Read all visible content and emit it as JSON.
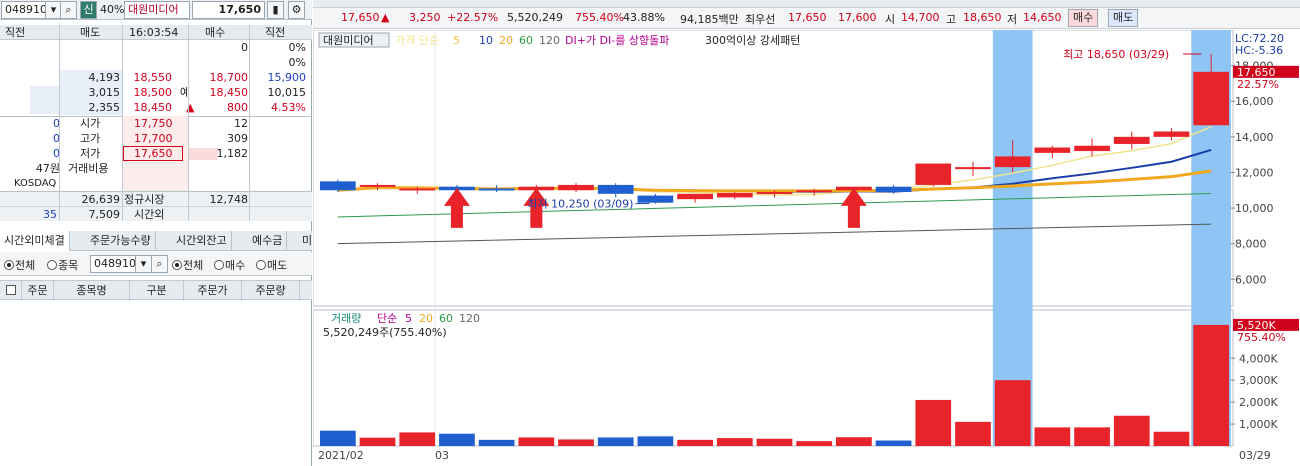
{
  "stock": {
    "code": "048910",
    "badge_credit": "신",
    "margin_rate": "40%",
    "name": "대원미디어",
    "price": "17,650"
  },
  "orderbook": {
    "headers": [
      "직전",
      "매도",
      "16:03:54",
      "매수",
      "직전"
    ],
    "rows": [
      {
        "c1": "",
        "sell": "",
        "price": "",
        "buy": "0",
        "c5": "0%"
      },
      {
        "c1": "",
        "sell": "",
        "price": "",
        "buy": "",
        "c5": "0%"
      },
      {
        "c1": "",
        "sell": "4,193",
        "price": "18,550",
        "buy": "18,700",
        "c5": "15,900"
      },
      {
        "c1": "",
        "sell": "3,015",
        "price": "18,500",
        "buy": "18,450",
        "c5": "10,015",
        "buy_prefix": "예"
      },
      {
        "c1": "",
        "sell": "2,355",
        "price": "18,450",
        "buy": "800",
        "c5": "4.53%",
        "buy_prefix": "▲"
      }
    ],
    "info": [
      {
        "c1": "0",
        "label": "시가",
        "value": "17,750",
        "extra": "12"
      },
      {
        "c1": "0",
        "label": "고가",
        "value": "17,700",
        "extra": "309"
      },
      {
        "c1": "0",
        "label": "저가",
        "value": "17,650",
        "extra": "1,182"
      },
      {
        "c1": "47원",
        "label": "거래비용",
        "value": "",
        "extra": ""
      },
      {
        "c1": "KOSDAQ",
        "label": "",
        "value": "",
        "extra": ""
      }
    ],
    "totals": [
      {
        "sell": "26,639",
        "label": "정규시장",
        "buy": "12,748"
      },
      {
        "c1": "35",
        "sell": "7,509",
        "label": "시간외",
        "buy": ""
      }
    ]
  },
  "tabs": [
    "시간외미체결",
    "주문가능수량",
    "시간외잔고",
    "예수금",
    "미"
  ],
  "filters": {
    "all1": "전체",
    "stock": "종목",
    "code": "048910",
    "all2": "전체",
    "buy": "매수",
    "sell": "매도"
  },
  "table_headers": [
    "주문",
    "종목명",
    "구분",
    "주문가",
    "주문량"
  ],
  "quote": {
    "price": "17,650",
    "arrow": "▲",
    "change": "3,250",
    "change_pct": "+22.57%",
    "volume": "5,520,249",
    "vol_ratio": "755.40%",
    "turnover": "43.88%",
    "amount": "94,185백만",
    "best_label": "최우선",
    "best_ask": "17,650",
    "best_bid": "17,600",
    "open_label": "시",
    "open": "14,700",
    "high_label": "고",
    "high": "18,650",
    "low_label": "저",
    "low": "14,650",
    "buy_btn": "매수",
    "sell_btn": "매도"
  },
  "colors": {
    "up": "#e8232a",
    "down": "#1f5fcf",
    "highlight": "#8ec5f5",
    "ma5": "#f2e48c",
    "ma10": "#1a3ea8",
    "ma20": "#f0a820",
    "ma60": "#2e9a4a",
    "ma120": "#555555"
  },
  "chart_data": {
    "type": "candlestick",
    "legend": {
      "name": "대원미디어",
      "ma_label": "가격 단순",
      "ma5": "5",
      "ma10": "10",
      "ma20": "20",
      "ma60": "60",
      "ma120": "120",
      "signal1": "DI+가 DI-를 상향돌파",
      "signal2": "300억이상 강세패턴"
    },
    "vol_legend": {
      "name": "거래량",
      "ma_label": "단순",
      "ma5": "5",
      "ma20": "20",
      "ma60": "60",
      "ma120": "120",
      "value": "5,520,249주(755.40%)"
    },
    "lc": "LC:72.20",
    "hc": "HC:-5.36",
    "y_ticks": [
      6000,
      8000,
      10000,
      12000,
      14000,
      16000,
      18000
    ],
    "y_tick_labels": [
      "6,000",
      "8,000",
      "10,000",
      "12,000",
      "14,000",
      "16,000",
      "18,000"
    ],
    "vol_ticks": [
      1000,
      2000,
      3000,
      4000
    ],
    "vol_tick_labels": [
      "1,000K",
      "2,000K",
      "3,000K",
      "4,000K"
    ],
    "current_label": "17,650",
    "current_pct": "22.57%",
    "vol_current_label": "5,520K",
    "vol_current_pct": "755.40%",
    "max_label": "최고 18,650 (03/29)",
    "min_label": "최저 10,250 (03/09)",
    "x_labels": [
      "2021/02",
      "03",
      "03/29"
    ],
    "price_range": [
      4500,
      20000
    ],
    "volume_range": [
      0,
      6200
    ],
    "candles": [
      {
        "o": 11500,
        "h": 11600,
        "l": 10900,
        "c": 11000,
        "v": 700
      },
      {
        "o": 11200,
        "h": 11400,
        "l": 11000,
        "c": 11300,
        "v": 380
      },
      {
        "o": 11100,
        "h": 11200,
        "l": 10800,
        "c": 11100,
        "v": 620
      },
      {
        "o": 11200,
        "h": 11300,
        "l": 10900,
        "c": 11000,
        "v": 560
      },
      {
        "o": 11100,
        "h": 11300,
        "l": 10900,
        "c": 11000,
        "v": 280
      },
      {
        "o": 11000,
        "h": 11300,
        "l": 10900,
        "c": 11200,
        "v": 390
      },
      {
        "o": 11000,
        "h": 11400,
        "l": 10900,
        "c": 11300,
        "v": 300
      },
      {
        "o": 11300,
        "h": 11400,
        "l": 10600,
        "c": 10800,
        "v": 390
      },
      {
        "o": 10700,
        "h": 10800,
        "l": 10250,
        "c": 10300,
        "v": 440
      },
      {
        "o": 10500,
        "h": 10800,
        "l": 10300,
        "c": 10800,
        "v": 280
      },
      {
        "o": 10600,
        "h": 10900,
        "l": 10500,
        "c": 10850,
        "v": 360
      },
      {
        "o": 10800,
        "h": 11000,
        "l": 10600,
        "c": 10900,
        "v": 330
      },
      {
        "o": 10900,
        "h": 11100,
        "l": 10700,
        "c": 11000,
        "v": 220
      },
      {
        "o": 11000,
        "h": 11200,
        "l": 10800,
        "c": 11200,
        "v": 400
      },
      {
        "o": 11200,
        "h": 11300,
        "l": 10800,
        "c": 10900,
        "v": 250
      },
      {
        "o": 11300,
        "h": 12500,
        "l": 11200,
        "c": 12500,
        "v": 2100
      },
      {
        "o": 12300,
        "h": 12600,
        "l": 11800,
        "c": 12300,
        "v": 1100
      },
      {
        "o": 12300,
        "h": 13800,
        "l": 12000,
        "c": 12900,
        "v": 3000
      },
      {
        "o": 13100,
        "h": 13500,
        "l": 12800,
        "c": 13400,
        "v": 850
      },
      {
        "o": 13200,
        "h": 13900,
        "l": 12900,
        "c": 13500,
        "v": 850
      },
      {
        "o": 13600,
        "h": 14300,
        "l": 13300,
        "c": 14000,
        "v": 1380
      },
      {
        "o": 14000,
        "h": 14500,
        "l": 13800,
        "c": 14300,
        "v": 650
      },
      {
        "o": 14650,
        "h": 18650,
        "l": 14650,
        "c": 17650,
        "v": 5520
      }
    ],
    "highlight_indices": [
      17,
      22
    ],
    "signal_arrow_indices": [
      3,
      5,
      13
    ]
  }
}
